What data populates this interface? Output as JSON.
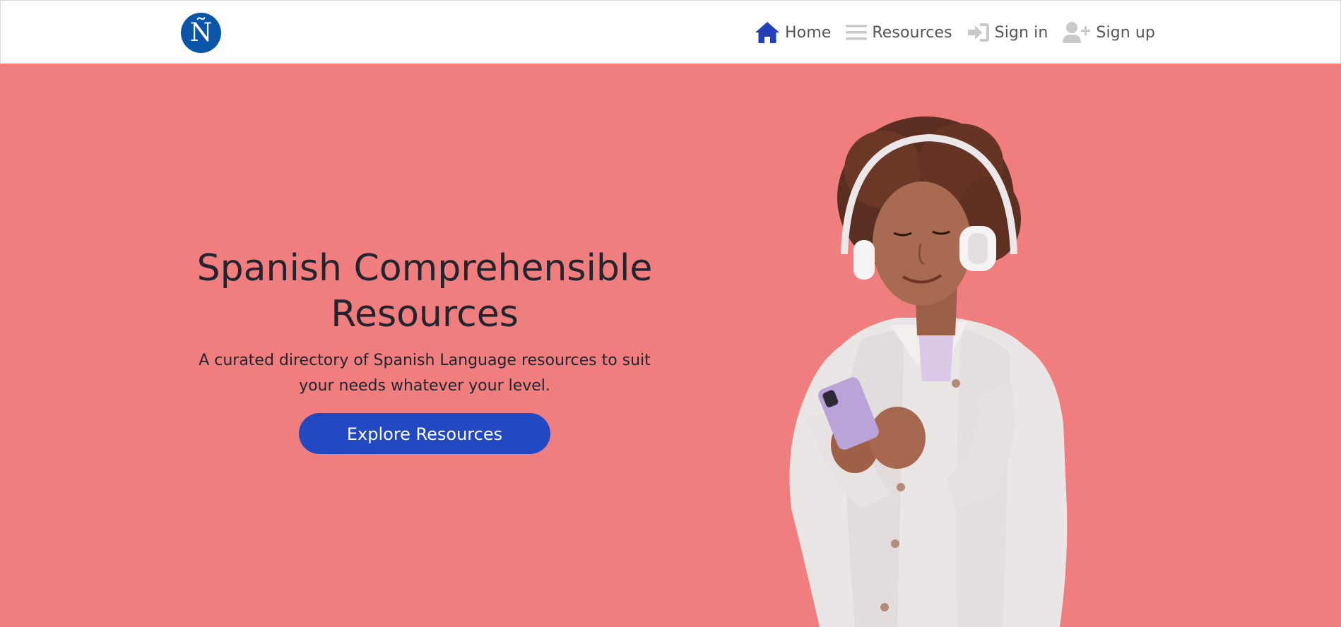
{
  "logo": {
    "glyph": "Ñ",
    "color": "#0b55a8"
  },
  "nav": {
    "items": [
      {
        "label": "Home",
        "icon": "home-icon",
        "color": "#2340b8"
      },
      {
        "label": "Resources",
        "icon": "menu-icon",
        "color": "#c9c9c9"
      },
      {
        "label": "Sign in",
        "icon": "sign-in-icon",
        "color": "#c9c9c9"
      },
      {
        "label": "Sign up",
        "icon": "user-plus-icon",
        "color": "#c9c9c9"
      }
    ]
  },
  "hero": {
    "title": "Spanish Comprehensible Resources",
    "subtitle": "A curated directory of Spanish Language resources to suit your needs whatever your level.",
    "button_label": "Explore Resources",
    "background": "#f07e7e",
    "button_color": "#2349c2"
  }
}
